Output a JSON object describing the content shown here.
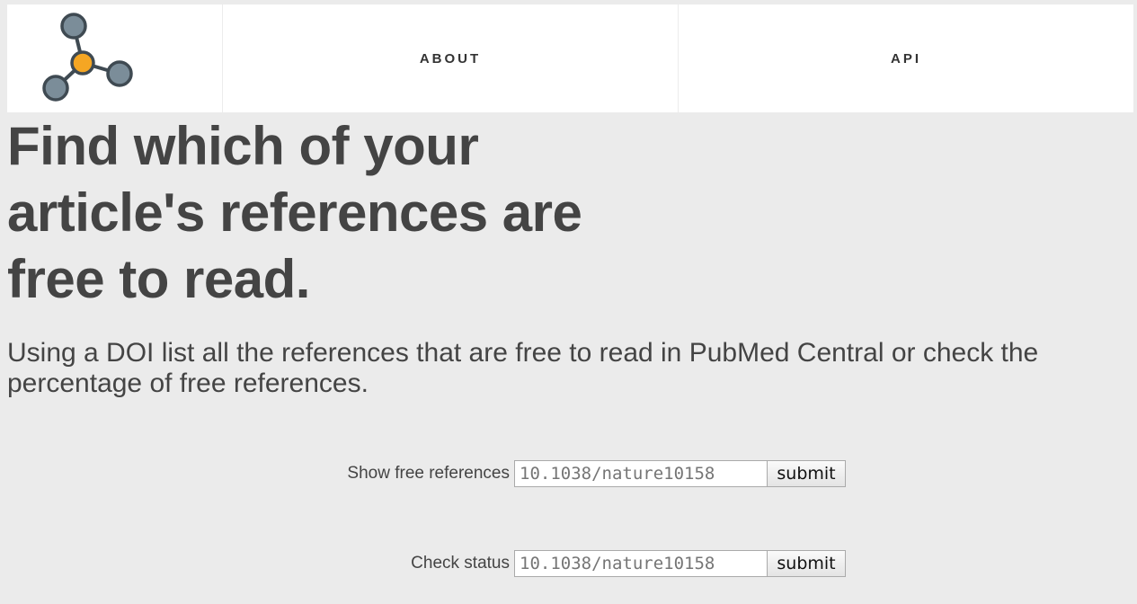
{
  "nav": {
    "logo_name": "molecule-logo-icon",
    "items": [
      {
        "label": "ABOUT"
      },
      {
        "label": "API"
      }
    ]
  },
  "hero": {
    "headline": "Find which of your article's references are free to read.",
    "lead": "Using a DOI list all the references that are free to read in PubMed Central or check the percentage of free references."
  },
  "forms": [
    {
      "label": "Show free references",
      "placeholder": "10.1038/nature10158",
      "button": "submit"
    },
    {
      "label": "Check status",
      "placeholder": "10.1038/nature10158",
      "button": "submit"
    }
  ],
  "colors": {
    "background": "#ebebeb",
    "text": "#444444",
    "logo_node": "#7b8d99",
    "logo_center": "#f5a623",
    "logo_stroke": "#3f4a52"
  }
}
